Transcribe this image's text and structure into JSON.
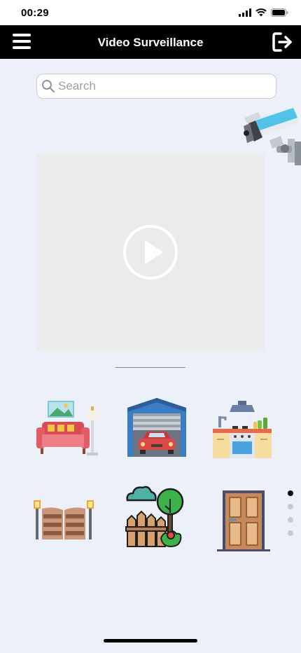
{
  "status": {
    "time": "00:29"
  },
  "header": {
    "title": "Video Surveillance"
  },
  "search": {
    "placeholder": "Search",
    "value": ""
  },
  "rooms": [
    {
      "id": "living-room",
      "icon": "living-room-icon"
    },
    {
      "id": "garage",
      "icon": "garage-icon"
    },
    {
      "id": "kitchen",
      "icon": "kitchen-icon"
    },
    {
      "id": "gate",
      "icon": "gate-icon"
    },
    {
      "id": "garden",
      "icon": "garden-icon"
    },
    {
      "id": "door",
      "icon": "door-icon"
    }
  ],
  "pagination": {
    "pages": 4,
    "active": 0
  },
  "colors": {
    "header": "#000000",
    "background": "#ecf0f8",
    "video_bg": "#ebebeb"
  }
}
